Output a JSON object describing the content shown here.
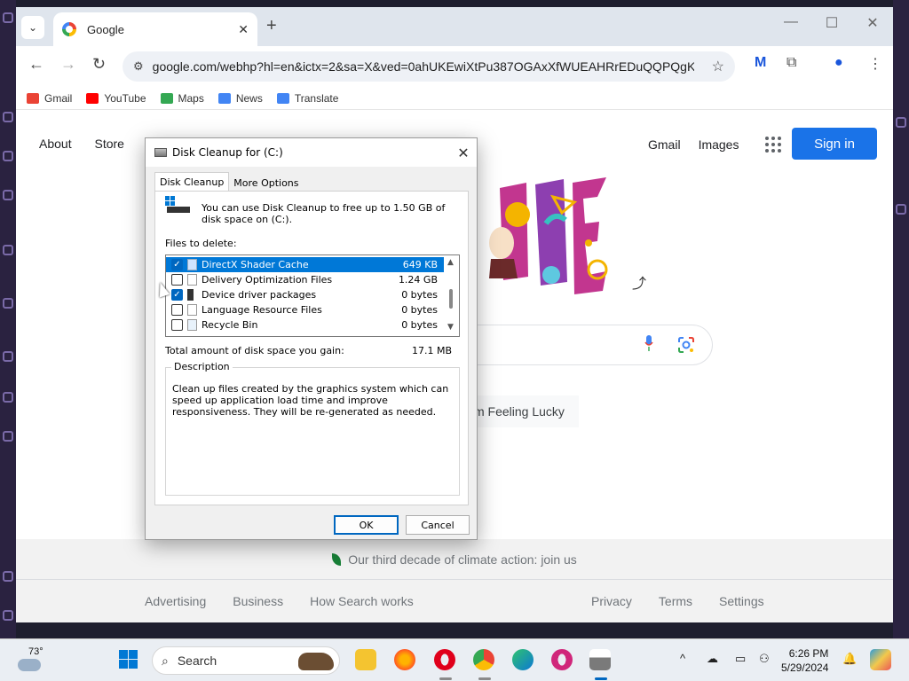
{
  "browser": {
    "tab_title": "Google",
    "tab_close": "✕",
    "new_tab": "+",
    "tab_dropdown": "⌄",
    "window_controls": {
      "minimize": "—",
      "maximize": "☐",
      "close": "✕"
    },
    "back": "←",
    "forward": "→",
    "reload": "↻",
    "site_info_icon": "⚙",
    "url": "google.com/webhp?hl=en&ictx=2&sa=X&ved=0ahUKEwiXtPu387OGAxXfWUEAHRrEDuQQPQgK",
    "star": "☆",
    "extension_icon": "M",
    "puzzle_icon": "⧉",
    "profile_icon": "●",
    "menu_icon": "⋮"
  },
  "bookmarks": [
    {
      "label": "Gmail",
      "color": "#ea4335"
    },
    {
      "label": "YouTube",
      "color": "#ff0000"
    },
    {
      "label": "Maps",
      "color": "#34a853"
    },
    {
      "label": "News",
      "color": "#4285f4"
    },
    {
      "label": "Translate",
      "color": "#4285f4"
    }
  ],
  "google": {
    "about": "About",
    "store": "Store",
    "gmail": "Gmail",
    "images": "Images",
    "sign_in": "Sign in",
    "lucky": "m Feeling Lucky",
    "share": "⤴",
    "climate": "Our third decade of climate action: join us",
    "footer_left": [
      "Advertising",
      "Business",
      "How Search works"
    ],
    "footer_right": [
      "Privacy",
      "Terms",
      "Settings"
    ]
  },
  "dialog": {
    "title": "Disk Cleanup for  (C:)",
    "close": "✕",
    "tabs": [
      "Disk Cleanup",
      "More Options"
    ],
    "intro": "You can use Disk Cleanup to free up to 1.50 GB of disk space on  (C:).",
    "files_to_delete": "Files to delete:",
    "files": [
      {
        "name": "DirectX Shader Cache",
        "size": "649 KB",
        "checked": true,
        "selected": true
      },
      {
        "name": "Delivery Optimization Files",
        "size": "1.24 GB",
        "checked": false,
        "selected": false
      },
      {
        "name": "Device driver packages",
        "size": "0 bytes",
        "checked": true,
        "selected": false
      },
      {
        "name": "Language Resource Files",
        "size": "0 bytes",
        "checked": false,
        "selected": false
      },
      {
        "name": "Recycle Bin",
        "size": "0 bytes",
        "checked": false,
        "selected": false
      }
    ],
    "gain_label": "Total amount of disk space you gain:",
    "gain_value": "17.1 MB",
    "description_label": "Description",
    "description": "Clean up files created by the graphics system which can speed up application load time and improve responsiveness. They will be re-generated as needed.",
    "ok": "OK",
    "cancel": "Cancel"
  },
  "taskbar": {
    "temperature": "73°",
    "search_placeholder": "Search",
    "time": "6:26 PM",
    "date": "5/29/2024"
  }
}
